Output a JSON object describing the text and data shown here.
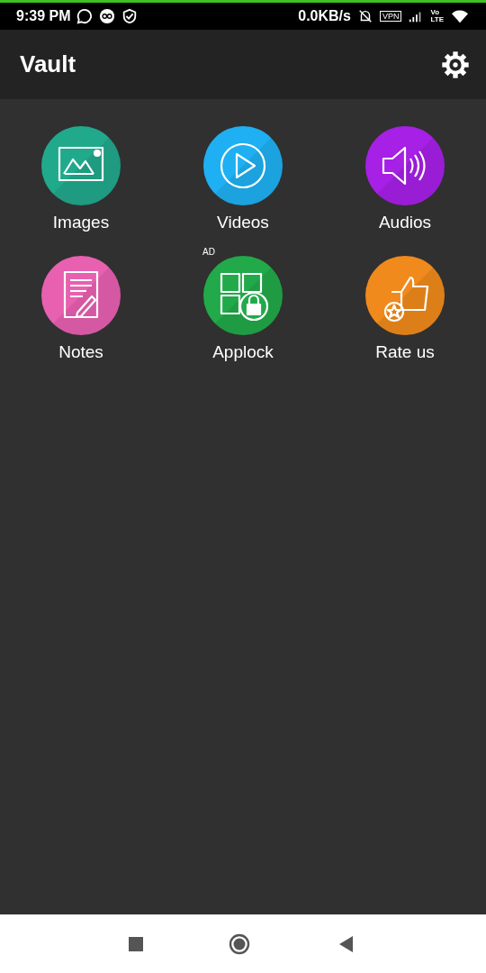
{
  "status_bar": {
    "time": "9:39 PM",
    "speed": "0.0KB/s",
    "vpn": "VPN",
    "volte_top": "Vo",
    "volte_bottom": "LTE"
  },
  "app_bar": {
    "title": "Vault"
  },
  "items": [
    {
      "label": "Images",
      "kind": "images",
      "color": "#21a98c"
    },
    {
      "label": "Videos",
      "kind": "videos",
      "color": "#1eb0f2"
    },
    {
      "label": "Audios",
      "kind": "audios",
      "color": "#a620e6"
    },
    {
      "label": "Notes",
      "kind": "notes",
      "color": "#e860b0"
    },
    {
      "label": "Applock",
      "kind": "applock",
      "color": "#22a94a",
      "badge": "AD"
    },
    {
      "label": "Rate us",
      "kind": "rate",
      "color": "#f08a1c"
    }
  ]
}
